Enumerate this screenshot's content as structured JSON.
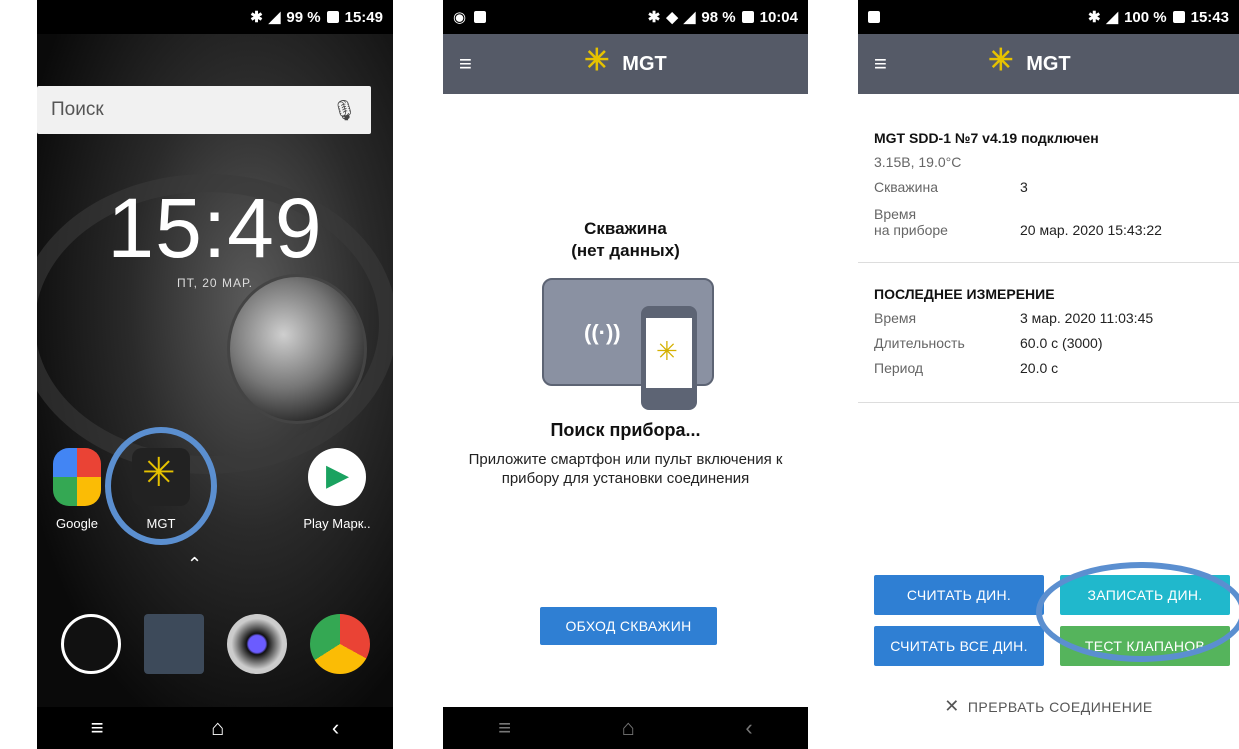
{
  "phone1": {
    "status": {
      "battery": "99 %",
      "time": "15:49"
    },
    "search_placeholder": "Поиск",
    "clock": "15:49",
    "date": "ПТ, 20 МАР.",
    "apps": [
      {
        "label": "Google"
      },
      {
        "label": "MGT"
      },
      {
        "label": "Play Марк.."
      }
    ]
  },
  "phone2": {
    "status": {
      "battery": "98 %",
      "time": "10:04"
    },
    "app_title": "MGT",
    "well_title": "Скважина",
    "well_subtitle": "(нет данных)",
    "nfc_wave": "((·))",
    "search_title": "Поиск прибора...",
    "search_desc": "Приложите смартфон или пульт включения к прибору для установки соединения",
    "bypass_button": "ОБХОД СКВАЖИН"
  },
  "phone3": {
    "status": {
      "battery": "100 %",
      "time": "15:43"
    },
    "app_title": "MGT",
    "device": {
      "title": "MGT SDD-1 №7 v4.19 подключен",
      "voltage_temp": "3.15В, 19.0°C",
      "well_label": "Скважина",
      "well_value": "3",
      "time_label_1": "Время",
      "time_label_2": "на приборе",
      "time_value": "20 мар. 2020  15:43:22"
    },
    "last": {
      "title": "ПОСЛЕДНЕЕ ИЗМЕРЕНИЕ",
      "rows": [
        {
          "k": "Время",
          "v": "3 мар. 2020  11:03:45"
        },
        {
          "k": "Длительность",
          "v": "60.0 с (3000)"
        },
        {
          "k": "Период",
          "v": "20.0 с"
        }
      ]
    },
    "buttons": {
      "read_dyn": "СЧИТАТЬ ДИН.",
      "write_dyn": "ЗАПИСАТЬ ДИН.",
      "read_all": "СЧИТАТЬ ВСЕ ДИН.",
      "test_valves": "ТЕСТ КЛАПАНОВ"
    },
    "disconnect": "ПРЕРВАТЬ СОЕДИНЕНИЕ"
  }
}
